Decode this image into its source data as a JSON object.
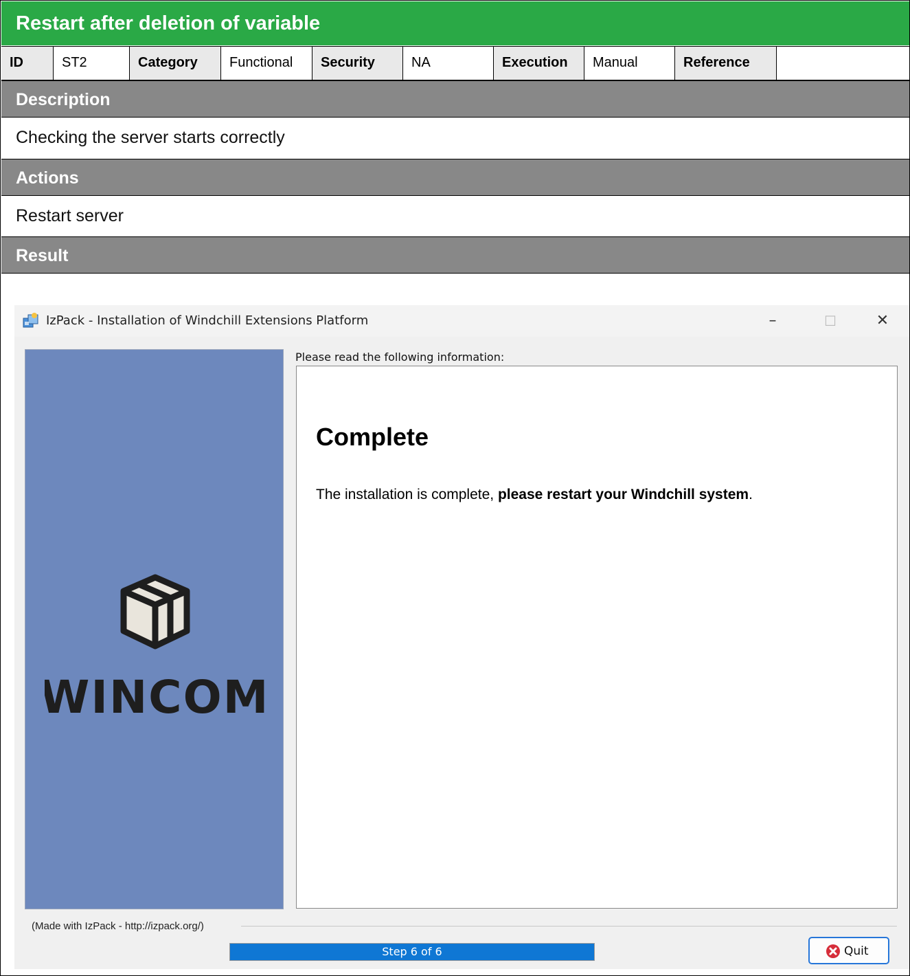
{
  "header": {
    "title": "Restart after deletion of variable"
  },
  "meta": [
    {
      "key": "ID",
      "value": "ST2"
    },
    {
      "key": "Category",
      "value": "Functional"
    },
    {
      "key": "Security",
      "value": "NA"
    },
    {
      "key": "Execution",
      "value": "Manual"
    },
    {
      "key": "Reference",
      "value": ""
    }
  ],
  "sections": {
    "description": {
      "label": "Description",
      "text": "Checking the server starts correctly"
    },
    "actions": {
      "label": "Actions",
      "text": "Restart server"
    },
    "result": {
      "label": "Result"
    }
  },
  "installer": {
    "window_title": "IzPack - Installation of  Windchill Extensions Platform",
    "controls": {
      "minimize": "–",
      "maximize": "☐",
      "close": "✕"
    },
    "logo_text": "WINCOM",
    "info_label": "Please read the following information:",
    "info_title": "Complete",
    "info_text_normal": "The installation is complete, ",
    "info_text_bold": "please restart your Windchill system",
    "info_text_end": ".",
    "made_with": "(Made with IzPack - http://izpack.org/)",
    "progress": {
      "label": "Step 6 of 6",
      "fraction": 1.0
    },
    "quit_label": "Quit"
  },
  "colors": {
    "title_bar": "#2aa946",
    "section_header": "#888888",
    "side_panel": "#6d88bd",
    "progress": "#0f77d4"
  },
  "icons": [
    "installer-app-icon",
    "wincom-box-icon",
    "quit-icon"
  ]
}
